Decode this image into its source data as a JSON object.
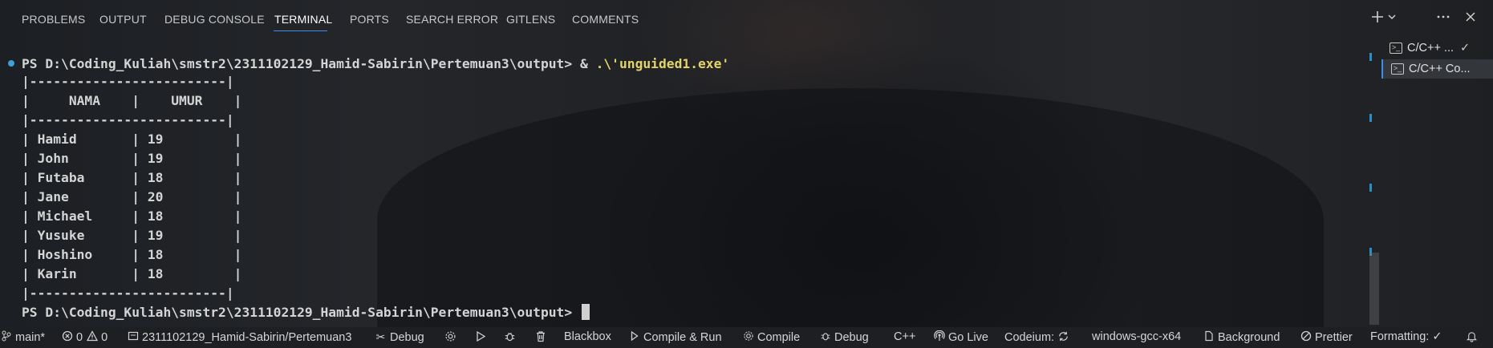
{
  "panel": {
    "tabs": [
      {
        "label": "PROBLEMS"
      },
      {
        "label": "OUTPUT"
      },
      {
        "label": "DEBUG CONSOLE"
      },
      {
        "label": "TERMINAL",
        "active": true
      },
      {
        "label": "PORTS"
      },
      {
        "label": "SEARCH ERROR"
      },
      {
        "label": "GITLENS"
      },
      {
        "label": "COMMENTS"
      }
    ],
    "actions": {
      "new_terminal_icon": "plus-icon",
      "dropdown_icon": "chevron-down-icon",
      "more_icon": "ellipsis-icon",
      "close_icon": "close-icon"
    }
  },
  "terminal": {
    "prompt": "PS D:\\Coding_Kuliah\\smstr2\\2311102129_Hamid-Sabirin\\Pertemuan3\\output> ",
    "command_amp": "& ",
    "command_str": ".\\'unguided1.exe'",
    "lines": [
      "|-------------------------|",
      "|     NAMA    |    UMUR    |",
      "|-------------------------|",
      "| Hamid       | 19         |",
      "| John        | 19         |",
      "| Futaba      | 18         |",
      "| Jane        | 20         |",
      "| Michael     | 18         |",
      "| Yusuke      | 19         |",
      "| Hoshino     | 18         |",
      "| Karin       | 18         |",
      "|-------------------------|"
    ],
    "final_prompt": "PS D:\\Coding_Kuliah\\smstr2\\2311102129_Hamid-Sabirin\\Pertemuan3\\output> "
  },
  "terminal_list": [
    {
      "label": "C/C++ ...",
      "check": "✓"
    },
    {
      "label": "C/C++ Co...",
      "selected": true
    }
  ],
  "statusbar": {
    "branch": "main*",
    "errors": "0",
    "warnings": "0",
    "project": "2311102129_Hamid-Sabirin/Pertemuan3",
    "debug1": "Debug",
    "blackbox": "Blackbox",
    "compile_run": "Compile & Run",
    "compile": "Compile",
    "debug2": "Debug",
    "language": "C++",
    "go_live": "Go Live",
    "codeium": "Codeium:",
    "compiler": "windows-gcc-x64",
    "background": "Background",
    "prettier": "Prettier",
    "formatting": "Formatting: ✓"
  },
  "colors": {
    "accent": "#3b8eea",
    "string": "#e2d568",
    "text": "#d4d4d4"
  }
}
